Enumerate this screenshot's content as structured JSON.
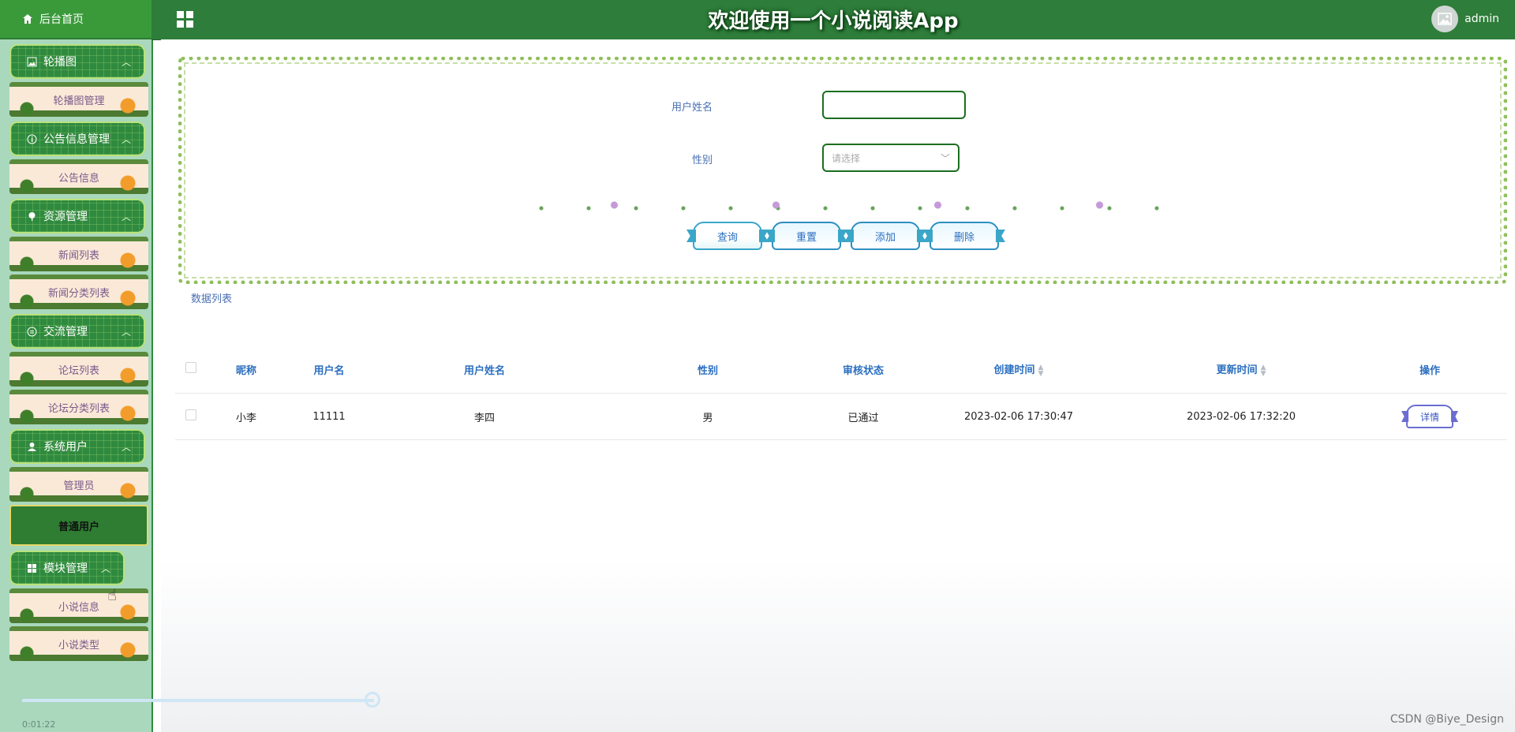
{
  "sidebar": {
    "home": "后台首页",
    "groups": [
      {
        "title": "轮播图",
        "icon": "image-icon",
        "items": [
          "轮播图管理"
        ]
      },
      {
        "title": "公告信息管理",
        "icon": "info-icon",
        "items": [
          "公告信息"
        ]
      },
      {
        "title": "资源管理",
        "icon": "pin-icon",
        "items": [
          "新闻列表",
          "新闻分类列表"
        ]
      },
      {
        "title": "交流管理",
        "icon": "chat-icon",
        "items": [
          "论坛列表",
          "论坛分类列表"
        ]
      },
      {
        "title": "系统用户",
        "icon": "user-icon",
        "items": [
          "管理员",
          "普通用户"
        ]
      },
      {
        "title": "模块管理",
        "icon": "grid-icon",
        "items": [
          "小说信息",
          "小说类型"
        ]
      }
    ],
    "active_item": "普通用户",
    "timestamp": "0:01:22"
  },
  "header": {
    "title": "欢迎使用一个小说阅读App",
    "username": "admin"
  },
  "search": {
    "name_label": "用户姓名",
    "name_value": "",
    "gender_label": "性别",
    "gender_placeholder": "请选择",
    "buttons": {
      "query": "查询",
      "reset": "重置",
      "add": "添加",
      "delete": "删除"
    }
  },
  "list_title": "数据列表",
  "table": {
    "columns": [
      "昵称",
      "用户名",
      "用户姓名",
      "性别",
      "审核状态",
      "创建时间",
      "更新时间",
      "操作"
    ],
    "rows": [
      {
        "nickname": "小李",
        "username": "11111",
        "real_name": "李四",
        "gender": "男",
        "status": "已通过",
        "created": "2023-02-06 17:30:47",
        "updated": "2023-02-06 17:32:20",
        "action": "详情"
      }
    ]
  },
  "watermark": "CSDN @Biye_Design",
  "colors": {
    "primary": "#2e7d3a",
    "link": "#2b6fbf"
  }
}
